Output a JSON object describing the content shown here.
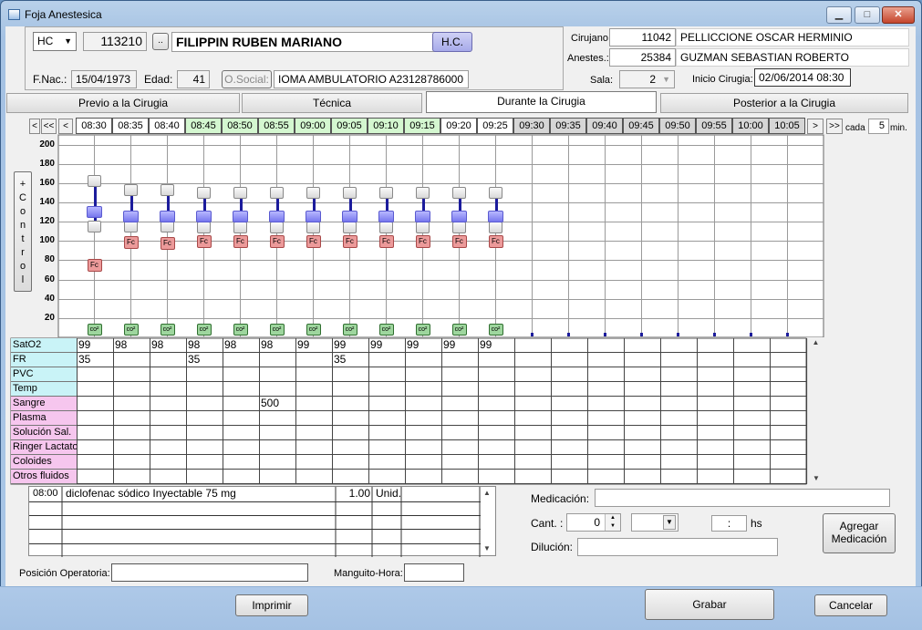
{
  "window": {
    "title": "Foja Anestesica",
    "min": "▁",
    "max": "□",
    "close": "✕"
  },
  "patient": {
    "doc_type": "HC",
    "hc_number": "113210",
    "dots": "..",
    "name": "FILIPPIN RUBEN MARIANO",
    "hc_button": "H.C.",
    "fnac_label": "F.Nac.:",
    "fnac": "15/04/1973",
    "edad_label": "Edad:",
    "edad": "41",
    "osocial_label": "O.Social:",
    "osocial": "IOMA AMBULATORIO A23128786000"
  },
  "staff": {
    "cirujano_label": "Cirujano:",
    "cirujano_id": "11042",
    "cirujano_name": "PELLICCIONE OSCAR HERMINIO",
    "anestes_label": "Anestes.:",
    "anestes_id": "25384",
    "anestes_name": "GUZMAN SEBASTIAN ROBERTO",
    "sala_label": "Sala:",
    "sala": "2",
    "inicio_label": "Inicio Cirugia:",
    "inicio": "02/06/2014 08:30"
  },
  "tabs": [
    "Previo a la Cirugia",
    "Técnica",
    "Durante la Cirugia",
    "Posterior a la Cirugia"
  ],
  "timeline": {
    "nav_first": "<",
    "nav_prev_page": "<<",
    "nav_prev": "<",
    "nav_next": ">",
    "nav_next_page": ">>",
    "times": [
      "08:30",
      "08:35",
      "08:40",
      "08:45",
      "08:50",
      "08:55",
      "09:00",
      "09:05",
      "09:10",
      "09:15",
      "09:20",
      "09:25",
      "09:30",
      "09:35",
      "09:40",
      "09:45",
      "09:50",
      "09:55",
      "10:00",
      "10:05"
    ],
    "green": [
      3,
      4,
      5,
      6,
      7,
      8,
      9
    ],
    "dark": [
      12,
      13,
      14,
      15,
      16,
      17,
      18,
      19
    ],
    "cada_label": "cada",
    "cada_value": "5",
    "min_label": "min."
  },
  "control_label": "+ C o n t r o l",
  "fc_label": "Fc",
  "o2_label": "co²",
  "chart_data": {
    "type": "scatter",
    "x": [
      "08:30",
      "08:35",
      "08:40",
      "08:45",
      "08:50",
      "08:55",
      "09:00",
      "09:05",
      "09:10",
      "09:15",
      "09:20",
      "09:25"
    ],
    "ylim": [
      0,
      210
    ],
    "yticks": [
      20,
      40,
      60,
      80,
      100,
      120,
      140,
      160,
      180,
      200
    ],
    "series": [
      {
        "name": "",
        "values": [
          162,
          153,
          153,
          150,
          150,
          150,
          150,
          150,
          150,
          150,
          150,
          150
        ]
      },
      {
        "name": "",
        "values": [
          130,
          125,
          125,
          125,
          125,
          125,
          125,
          125,
          125,
          125,
          125,
          125
        ]
      },
      {
        "name": "",
        "values": [
          115,
          115,
          115,
          114,
          114,
          114,
          114,
          114,
          114,
          114,
          114,
          114
        ]
      },
      {
        "name": "Fc",
        "values": [
          75,
          98,
          97,
          99,
          99,
          99,
          99,
          99,
          99,
          99,
          99,
          99
        ]
      },
      {
        "name": "co²",
        "values": [
          8,
          8,
          8,
          8,
          8,
          8,
          8,
          8,
          8,
          8,
          8,
          8
        ]
      }
    ]
  },
  "grid": {
    "rows": [
      {
        "label": "SatO2",
        "color": "#c9f3f7",
        "values": [
          "99",
          "98",
          "98",
          "98",
          "98",
          "98",
          "99",
          "99",
          "99",
          "99",
          "99",
          "99"
        ]
      },
      {
        "label": "FR",
        "color": "#c9f3f7",
        "values": [
          "35",
          "",
          "",
          "35",
          "",
          "",
          "",
          "35",
          "",
          "",
          "",
          ""
        ]
      },
      {
        "label": "PVC",
        "color": "#c9f3f7",
        "values": []
      },
      {
        "label": "Temp",
        "color": "#c9f3f7",
        "values": []
      },
      {
        "label": "Sangre",
        "color": "#f6c6ee",
        "values": [
          "",
          "",
          "",
          "",
          "",
          "500"
        ]
      },
      {
        "label": "Plasma",
        "color": "#f6c6ee",
        "values": []
      },
      {
        "label": "Solución Sal.",
        "color": "#f6c6ee",
        "values": []
      },
      {
        "label": "Ringer Lactato",
        "color": "#f6c6ee",
        "values": []
      },
      {
        "label": "Coloides",
        "color": "#f6c6ee",
        "values": []
      },
      {
        "label": "Otros fluidos",
        "color": "#f6c6ee",
        "values": []
      }
    ]
  },
  "medlist": {
    "rows": [
      {
        "time": "08:00",
        "desc": "diclofenac sódico Inyectable 75 mg",
        "qty": "1.00",
        "unit": "Unid."
      }
    ]
  },
  "medform": {
    "medicacion_label": "Medicación:",
    "medicacion": "",
    "cant_label": "Cant. :",
    "cant": "0",
    "hour_value": ":",
    "hs_label": "hs",
    "dilucion_label": "Dilución:",
    "dilucion": "",
    "agregar": "Agregar Medicación"
  },
  "bottom": {
    "posicion_label": "Posición Operatoria:",
    "posicion": "",
    "manguito_label": "Manguito-Hora:",
    "manguito": "",
    "imprimir": "Imprimir",
    "grabar": "Grabar",
    "cancelar": "Cancelar"
  }
}
